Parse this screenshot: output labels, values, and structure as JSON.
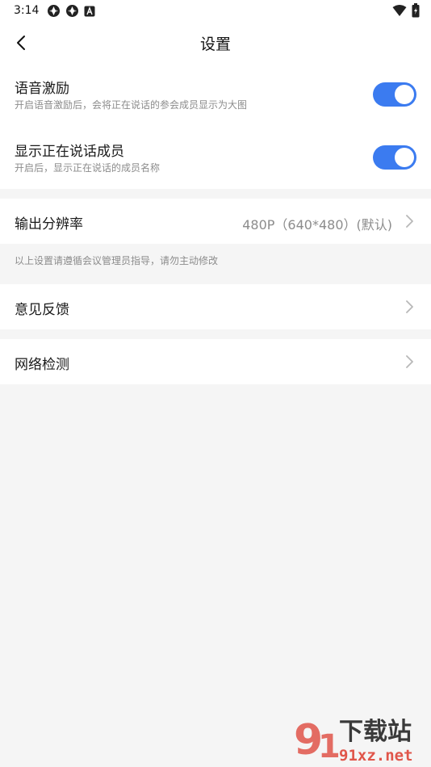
{
  "status_bar": {
    "time": "3:14",
    "left_icons": [
      "sync-icon",
      "sync-icon",
      "text-a-icon"
    ],
    "right_icons": [
      "wifi-icon",
      "battery-icon"
    ]
  },
  "header": {
    "title": "设置",
    "back_icon": "chevron-left-icon"
  },
  "toggles": [
    {
      "title": "语音激励",
      "description": "开启语音激励后，会将正在说话的参会成员显示为大图",
      "enabled": true
    },
    {
      "title": "显示正在说话成员",
      "description": "开启后，显示正在说话的成员名称",
      "enabled": true
    }
  ],
  "resolution": {
    "label": "输出分辨率",
    "value": "480P（640*480）(默认)"
  },
  "note": "以上设置请遵循会议管理员指导，请勿主动修改",
  "nav_items": [
    {
      "label": "意见反馈"
    },
    {
      "label": "网络检测"
    }
  ],
  "watermark": {
    "text_top": "下载站",
    "text_bottom": "91xz.net"
  },
  "colors": {
    "accent": "#3b7bf0",
    "background": "#f5f5f5",
    "watermark": "#e0554a"
  }
}
